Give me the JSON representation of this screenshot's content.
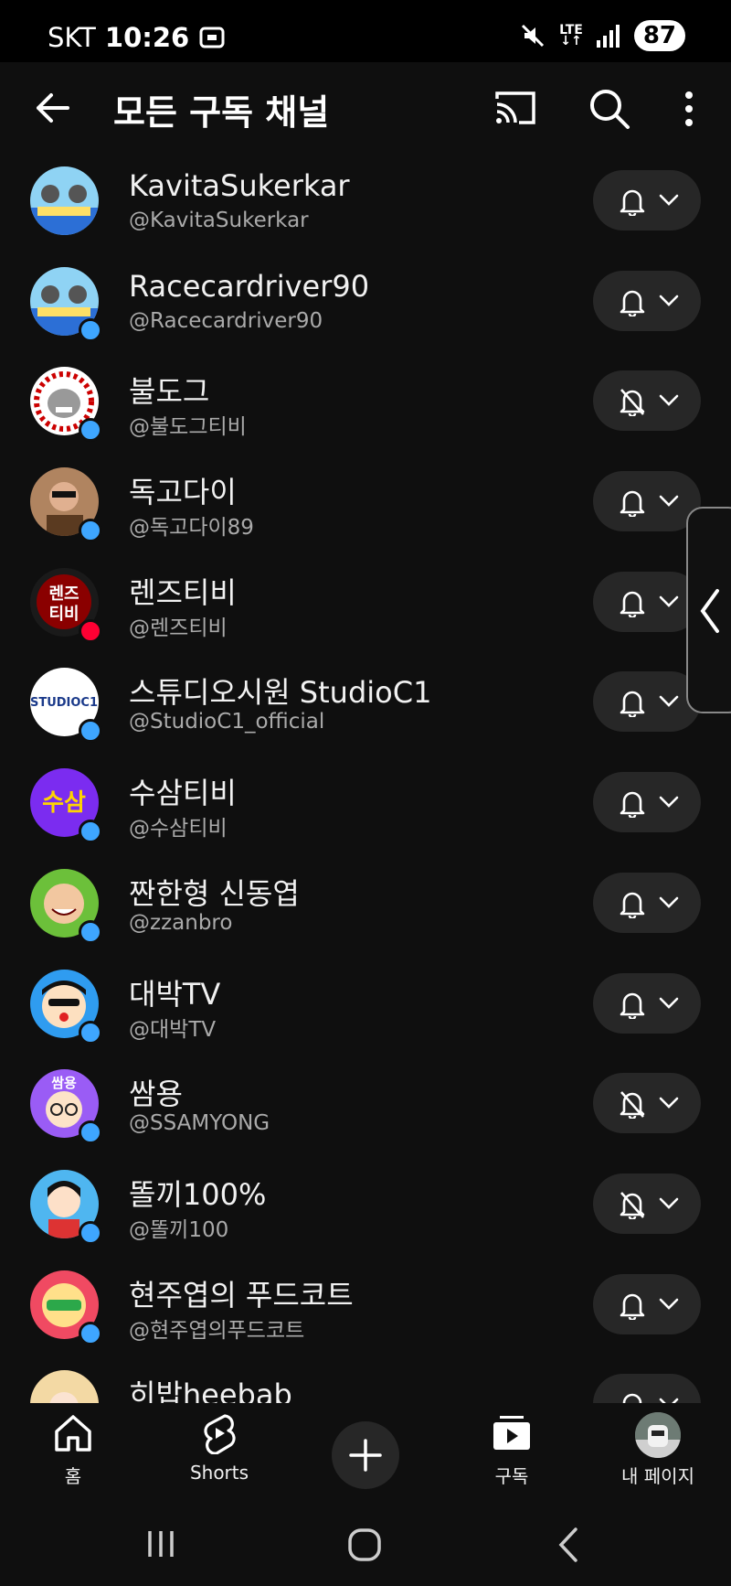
{
  "status_bar": {
    "carrier": "SKT",
    "time": "10:26",
    "network": "LTE",
    "battery": "87"
  },
  "header": {
    "title": "모든 구독 채널"
  },
  "channels": [
    {
      "name": "KavitaSukerkar",
      "handle": "@KavitaSukerkar",
      "notify": "on",
      "dot": "none",
      "avatar_color": "#8fd3f4"
    },
    {
      "name": "Racecardriver90",
      "handle": "@Racecardriver90",
      "notify": "on",
      "dot": "blue",
      "avatar_color": "#8fd3f4"
    },
    {
      "name": "불도그",
      "handle": "@불도그티비",
      "notify": "off",
      "dot": "blue",
      "avatar_color": "#e8e8e8"
    },
    {
      "name": "독고다이",
      "handle": "@독고다이89",
      "notify": "on",
      "dot": "blue",
      "avatar_color": "#b08460"
    },
    {
      "name": "렌즈티비",
      "handle": "@렌즈티비",
      "notify": "on",
      "dot": "red",
      "avatar_color": "#1a1a1a"
    },
    {
      "name": "스튜디오시원 StudioC1",
      "handle": "@StudioC1_official",
      "notify": "on",
      "dot": "blue",
      "avatar_color": "#ffffff"
    },
    {
      "name": "수삼티비",
      "handle": "@수삼티비",
      "notify": "on",
      "dot": "blue",
      "avatar_color": "#7b2cf0"
    },
    {
      "name": "짠한형 신동엽",
      "handle": "@zzanbro",
      "notify": "on",
      "dot": "blue",
      "avatar_color": "#6cc03a"
    },
    {
      "name": "대박TV",
      "handle": "@대박TV",
      "notify": "on",
      "dot": "blue",
      "avatar_color": "#2f9cf0"
    },
    {
      "name": "쌈용",
      "handle": "@SSAMYONG",
      "notify": "off",
      "dot": "blue",
      "avatar_color": "#9a5cf5"
    },
    {
      "name": "똘끼100%",
      "handle": "@똘끼100",
      "notify": "off",
      "dot": "blue",
      "avatar_color": "#4fb6f0"
    },
    {
      "name": "현주엽의 푸드코트",
      "handle": "@현주엽의푸드코트",
      "notify": "on",
      "dot": "blue",
      "avatar_color": "#f04a62"
    },
    {
      "name": "히밥heebab",
      "handle": "",
      "notify": "on",
      "dot": "none",
      "avatar_color": "#f3d9a4"
    }
  ],
  "avatar_texts": {
    "lens": "렌즈\n티비",
    "studio": "STUDIO C1",
    "susam": "수삼",
    "ssam": "쌈용"
  },
  "bottom_nav": {
    "home": "홈",
    "shorts": "Shorts",
    "subscriptions": "구독",
    "my_page": "내 페이지"
  },
  "colors": {
    "background": "#0f0f0f",
    "pill": "#272727",
    "accent_blue": "#3ea6ff",
    "live_red": "#ff0033"
  }
}
